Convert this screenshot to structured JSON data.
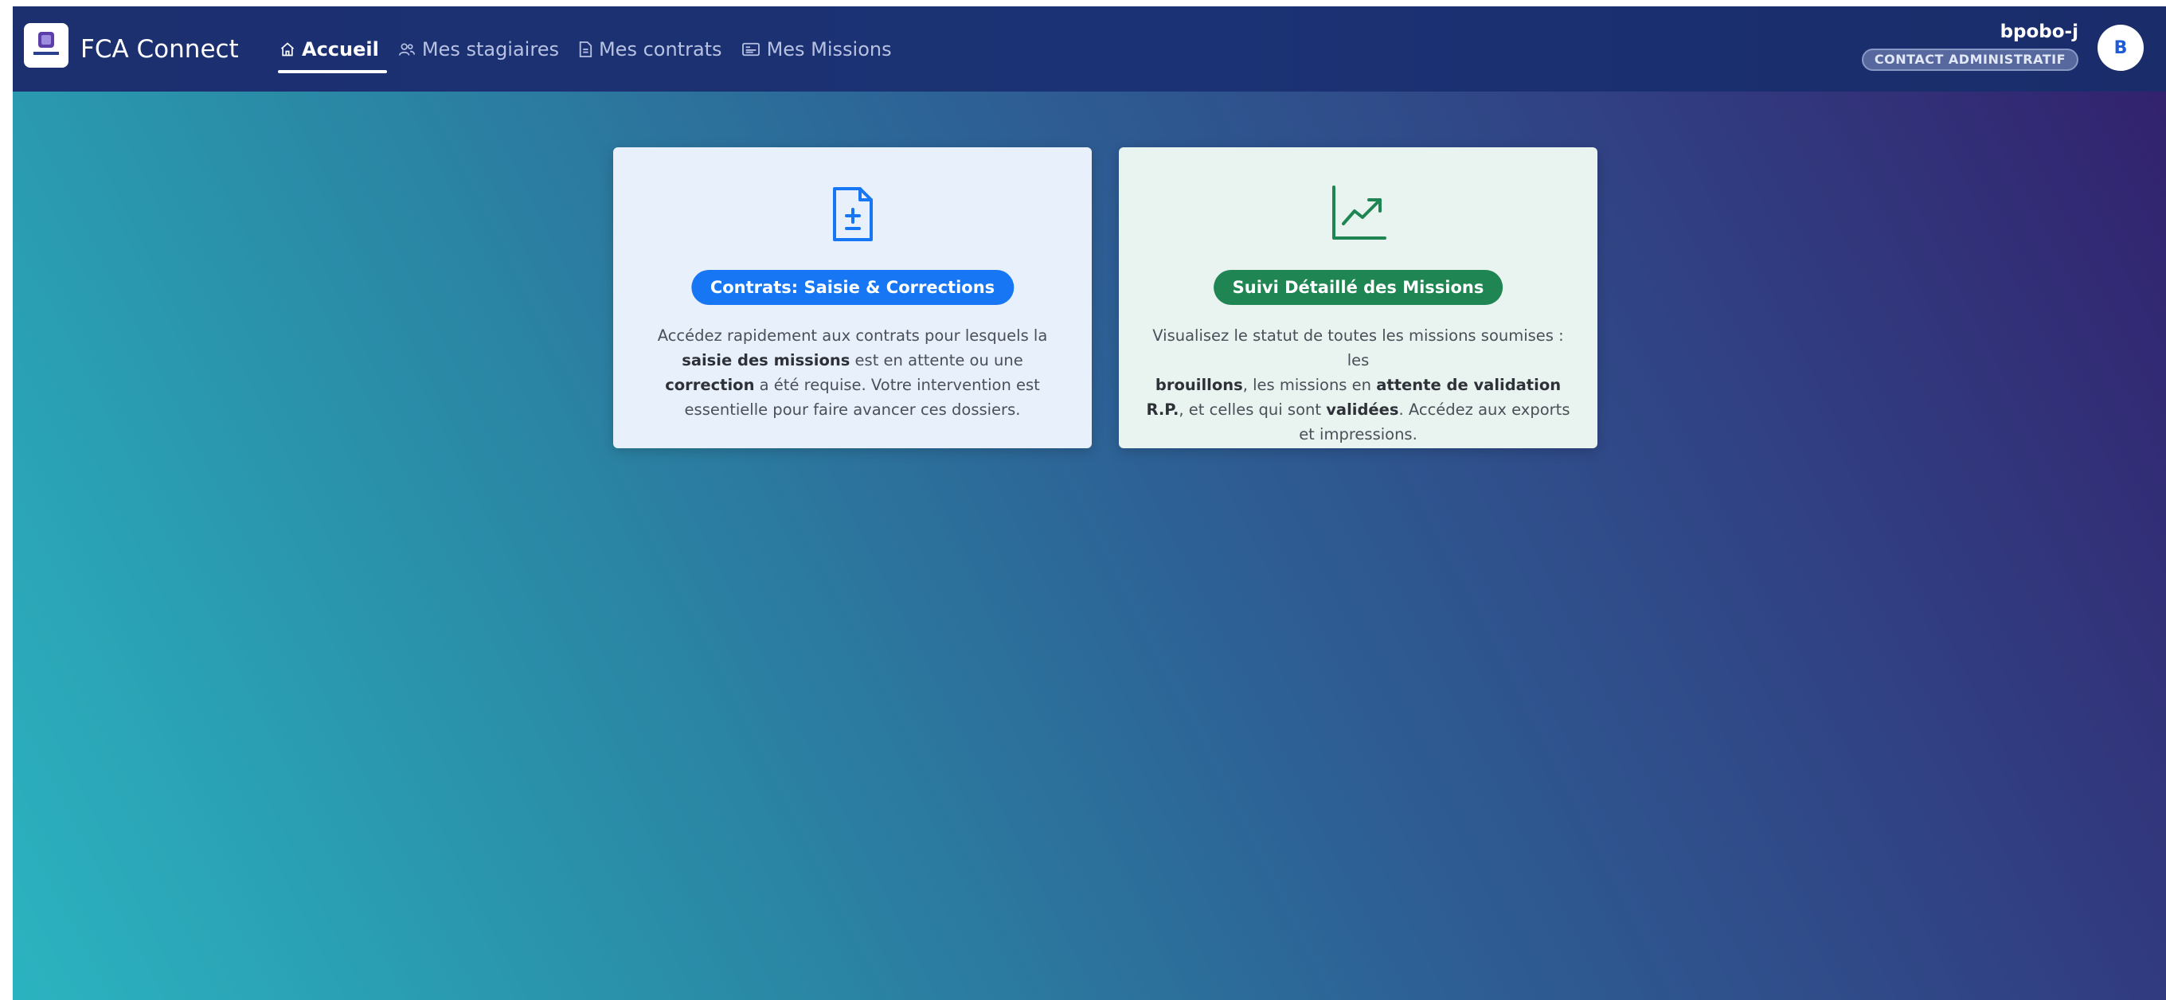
{
  "app": {
    "title": "FCA Connect",
    "logo_text": "FCA CONNECT"
  },
  "nav": {
    "items": [
      {
        "label": "Accueil",
        "icon": "home-icon",
        "active": true
      },
      {
        "label": "Mes stagiaires",
        "icon": "users-icon",
        "active": false
      },
      {
        "label": "Mes contrats",
        "icon": "document-icon",
        "active": false
      },
      {
        "label": "Mes Missions",
        "icon": "id-card-icon",
        "active": false
      }
    ]
  },
  "user": {
    "name": "bpobo-j",
    "role": "CONTACT ADMINISTRATIF",
    "avatar_letter": "B"
  },
  "cards": [
    {
      "icon": "file-plus-minus-icon",
      "button_label": "Contrats: Saisie & Corrections",
      "text": {
        "p1": "Accédez rapidement aux contrats pour lesquels la",
        "b1": "saisie des missions",
        "p2": " est en attente ou une ",
        "b2": "correction",
        "p3": " a été requise. Votre intervention est essentielle pour faire avancer ces dossiers."
      }
    },
    {
      "icon": "line-chart-icon",
      "button_label": "Suivi Détaillé des Missions",
      "text": {
        "p1": "Visualisez le statut de toutes les missions soumises : les",
        "b1": "brouillons",
        "p2": ", les missions en ",
        "b2": "attente de validation R.P.",
        "p3": ", et celles qui sont ",
        "b3": "validées",
        "p4": ". Accédez aux exports et impressions."
      }
    }
  ],
  "colors": {
    "header": "#1b3274",
    "primary_button": "#1676f3",
    "success_button": "#1f8553",
    "card_blue": "#e8f0fb",
    "card_green": "#e9f3ef"
  }
}
